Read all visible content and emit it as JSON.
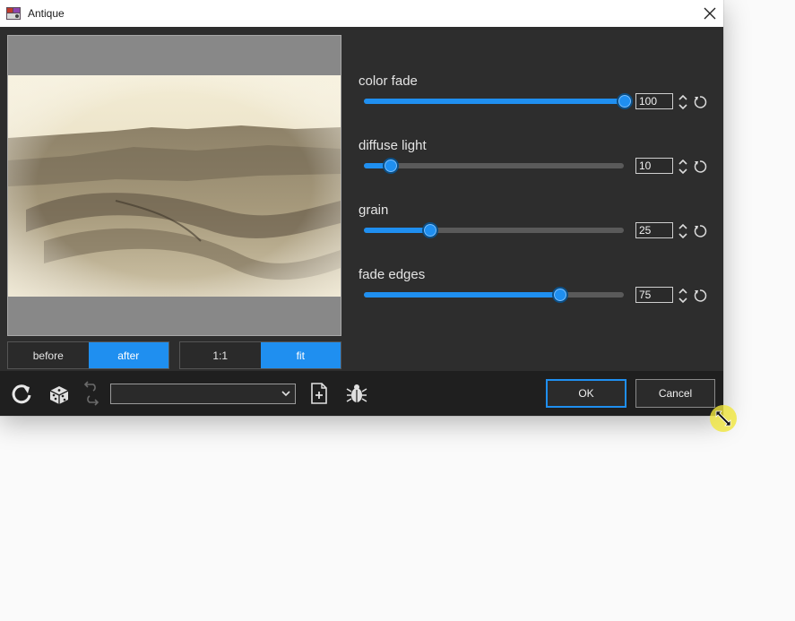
{
  "window": {
    "title": "Antique"
  },
  "icons": {
    "app": "app-icon",
    "close": "close-icon",
    "reset_all": "reset-icon",
    "random": "dice-icon",
    "undo": "undo-icon",
    "redo": "redo-icon",
    "new_preset": "new-file-icon",
    "debug": "bug-icon",
    "resize_cursor": "resize-cursor-icon"
  },
  "view_toggle": {
    "before": "before",
    "after": "after",
    "active": "after"
  },
  "zoom_toggle": {
    "one_to_one": "1:1",
    "fit": "fit",
    "active": "fit"
  },
  "sliders": [
    {
      "label": "color fade",
      "value": "100",
      "percent": 100
    },
    {
      "label": "diffuse light",
      "value": "10",
      "percent": 10
    },
    {
      "label": "grain",
      "value": "25",
      "percent": 25
    },
    {
      "label": "fade edges",
      "value": "75",
      "percent": 75
    }
  ],
  "preset_select": {
    "value": ""
  },
  "buttons": {
    "ok": "OK",
    "cancel": "Cancel"
  },
  "colors": {
    "accent": "#1f8ff0",
    "panel": "#2d2d2d",
    "bottombar": "#1f1f1f"
  }
}
